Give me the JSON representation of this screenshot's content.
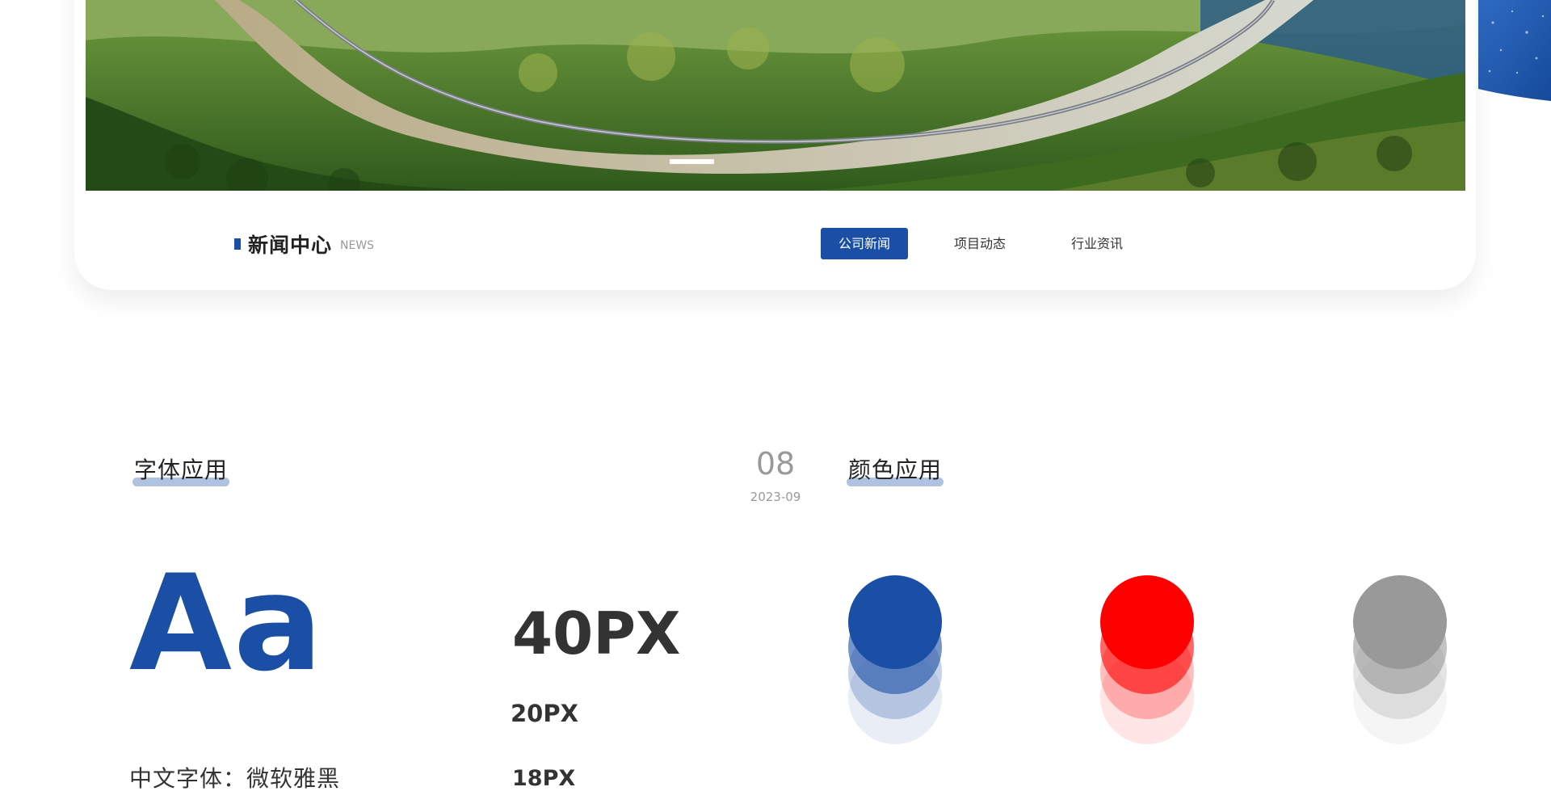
{
  "news": {
    "title": "新闻中心",
    "subtitle": "NEWS",
    "tabs": [
      {
        "label": "公司新闻",
        "active": true
      },
      {
        "label": "项目动态",
        "active": false
      },
      {
        "label": "行业资讯",
        "active": false
      }
    ]
  },
  "hero": {
    "slides": 1,
    "active_slide": 1
  },
  "font_section": {
    "title": "字体应用",
    "sample_glyph": "Aa",
    "sizes": [
      "40PX",
      "20PX",
      "18PX"
    ],
    "chinese_font_label": "中文字体：微软雅黑"
  },
  "date": {
    "day": "08",
    "month": "2023-09"
  },
  "color_section": {
    "title": "颜色应用",
    "colors": [
      "#1b4fa5",
      "#ff0000",
      "#999999"
    ]
  }
}
